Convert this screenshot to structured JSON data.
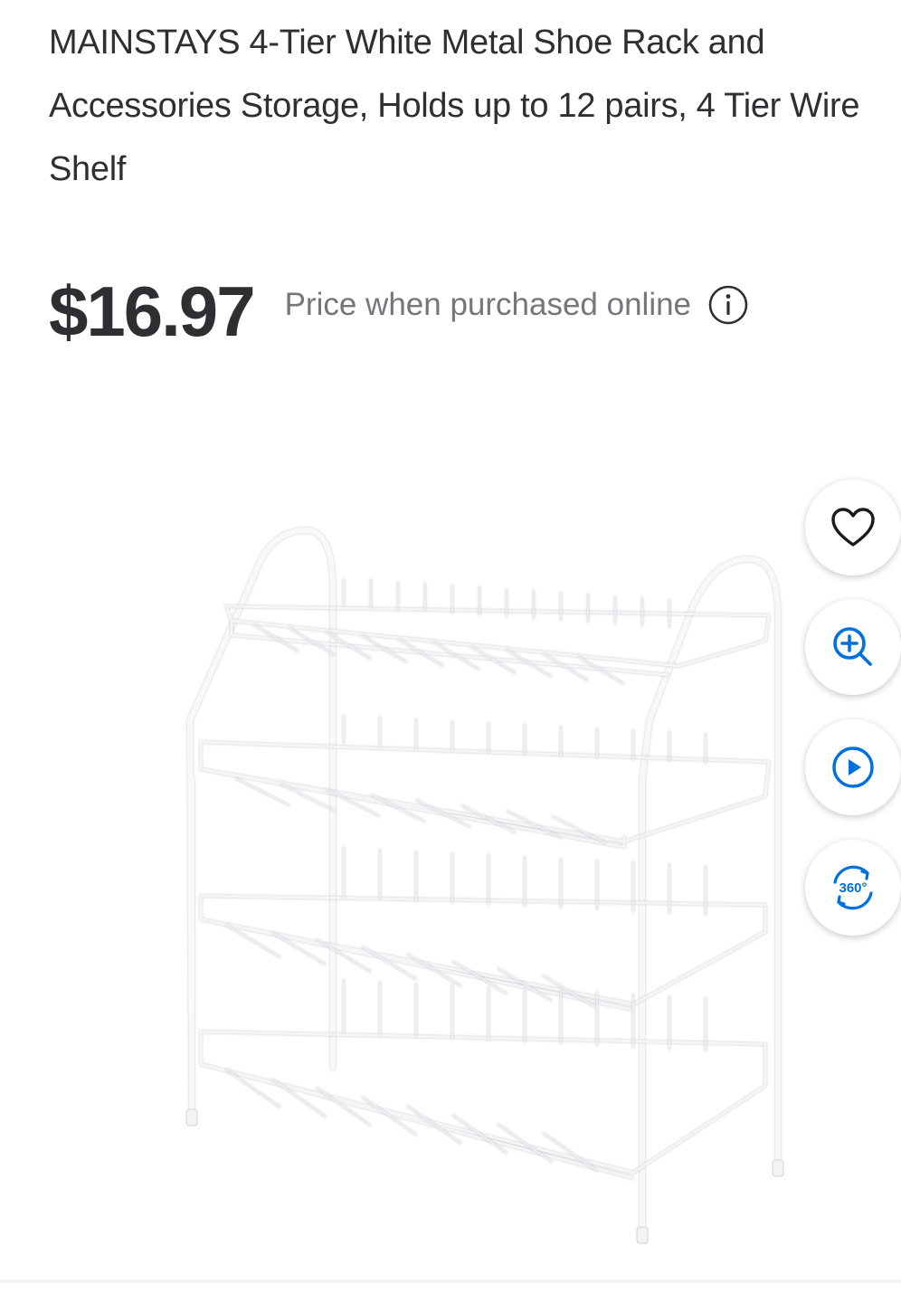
{
  "product": {
    "title": "MAINSTAYS 4-Tier White Metal Shoe Rack and Accessories Storage, Holds up to 12 pairs, 4 Tier Wire Shelf",
    "price": "$16.97",
    "price_note": "Price when purchased online",
    "image_alt": "MAINSTAYS 4-Tier White Metal Shoe Rack"
  },
  "actions": {
    "favorite_icon": "heart-icon",
    "zoom_icon": "zoom-in-icon",
    "video_icon": "play-icon",
    "view360_icon": "360-view-icon",
    "view360_label": "360°"
  },
  "colors": {
    "text": "#2e2f32",
    "muted": "#74767c",
    "accent": "#0071dc"
  }
}
